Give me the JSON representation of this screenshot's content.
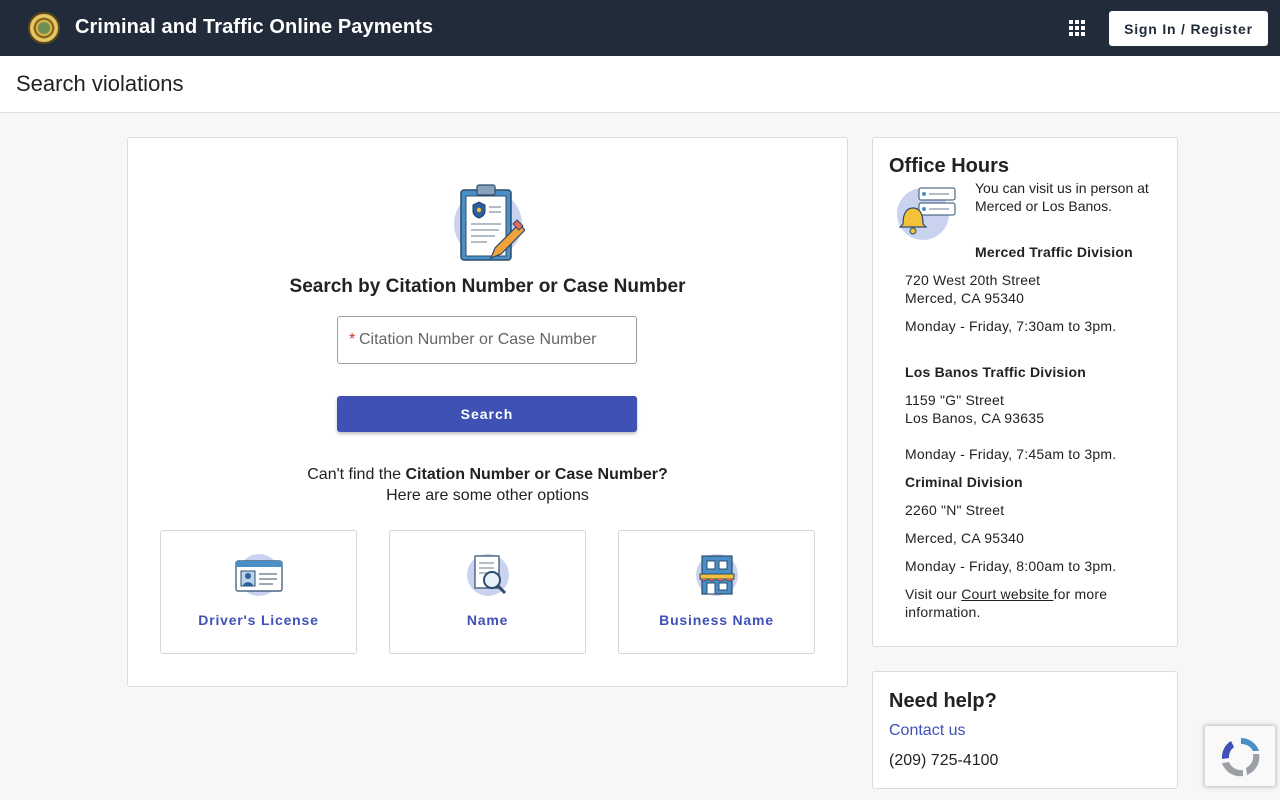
{
  "header": {
    "app_title": "Criminal and Traffic Online Payments",
    "signin_label": "Sign In / Register"
  },
  "page": {
    "title": "Search violations"
  },
  "search": {
    "heading": "Search by Citation Number or Case Number",
    "required_mark": "*",
    "placeholder": "Citation Number or Case Number",
    "value": "",
    "button_label": "Search",
    "cant_find_prefix": "Can't find the ",
    "cant_find_bold": "Citation Number or Case Number?",
    "other_options": "Here are some other options"
  },
  "options": [
    {
      "label": "Driver's License",
      "icon": "id-card-icon"
    },
    {
      "label": "Name",
      "icon": "document-magnifier-icon"
    },
    {
      "label": "Business Name",
      "icon": "storefront-icon"
    }
  ],
  "office_hours": {
    "title": "Office Hours",
    "intro": "You can visit us in person at Merced or Los Banos.",
    "merced": {
      "name": "Merced Traffic Division",
      "address1": "720 West 20th Street",
      "address2": "Merced, CA 95340",
      "hours": "Monday - Friday, 7:30am to 3pm."
    },
    "losbanos": {
      "name": "Los Banos Traffic Division",
      "address1": "1159 \"G\" Street",
      "address2": "Los Banos, CA 93635",
      "hours": "Monday - Friday, 7:45am to 3pm."
    },
    "criminal": {
      "name": "Criminal Division",
      "address1": "2260 \"N\" Street",
      "address2": "Merced, CA 95340",
      "hours": "Monday - Friday, 8:00am to 3pm."
    },
    "visit_prefix": "Visit our ",
    "court_link": "Court website ",
    "visit_suffix": "for more",
    "visit_line2": "information."
  },
  "help": {
    "title": "Need help?",
    "contact_label": "Contact us",
    "phone": "(209) 725-4100"
  },
  "colors": {
    "topbar": "#222b3a",
    "accent": "#3f51b5",
    "background": "#f7f7f7"
  }
}
